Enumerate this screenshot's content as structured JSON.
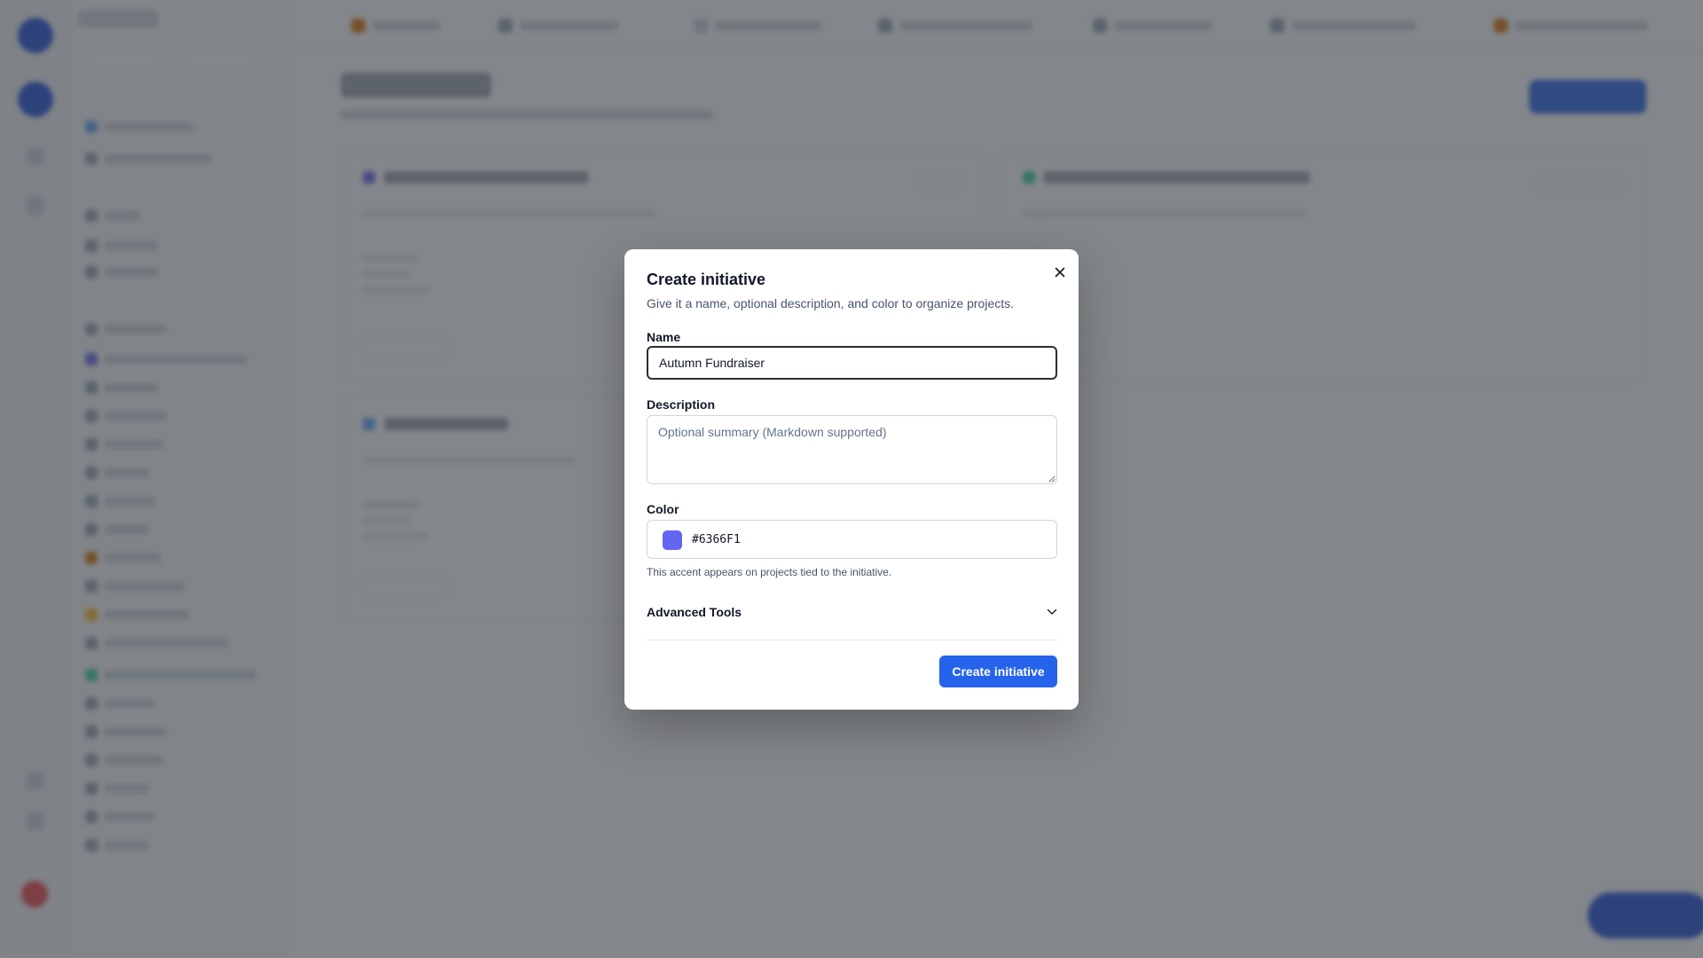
{
  "modal": {
    "title": "Create initiative",
    "subtitle": "Give it a name, optional description, and color to organize projects.",
    "close_icon": "close-icon",
    "name_label": "Name",
    "name_value": "Autumn Fundraiser",
    "description_label": "Description",
    "description_placeholder": "Optional summary (Markdown supported)",
    "color_label": "Color",
    "color_value": "#6366F1",
    "color_hint": "This accent appears on projects tied to the initiative.",
    "advanced_label": "Advanced Tools",
    "advanced_icon": "chevron-down-icon",
    "submit_label": "Create initiative"
  },
  "colors": {
    "accent": "#6366F1",
    "primary_button": "#2563EB",
    "overlay": "#373C42"
  }
}
